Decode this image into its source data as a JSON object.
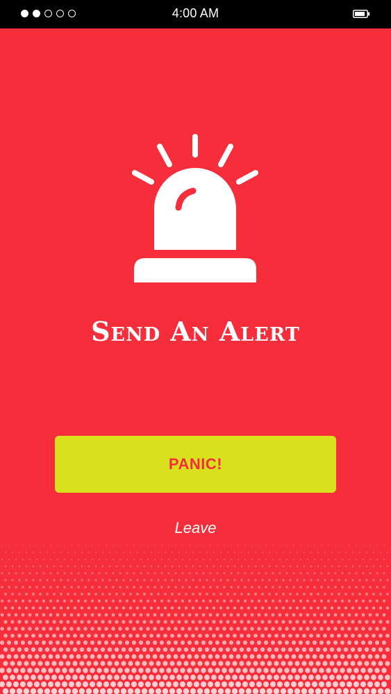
{
  "status_bar": {
    "time": "4:00 AM",
    "signal_filled": 2,
    "signal_total": 5
  },
  "alert": {
    "icon": "siren-icon",
    "title": "Send An Alert",
    "panic_label": "PANIC!",
    "leave_label": "Leave"
  },
  "colors": {
    "background": "#f62e3b",
    "button": "#d9e01e",
    "button_text": "#f62e3b",
    "status_bar": "#000000"
  }
}
